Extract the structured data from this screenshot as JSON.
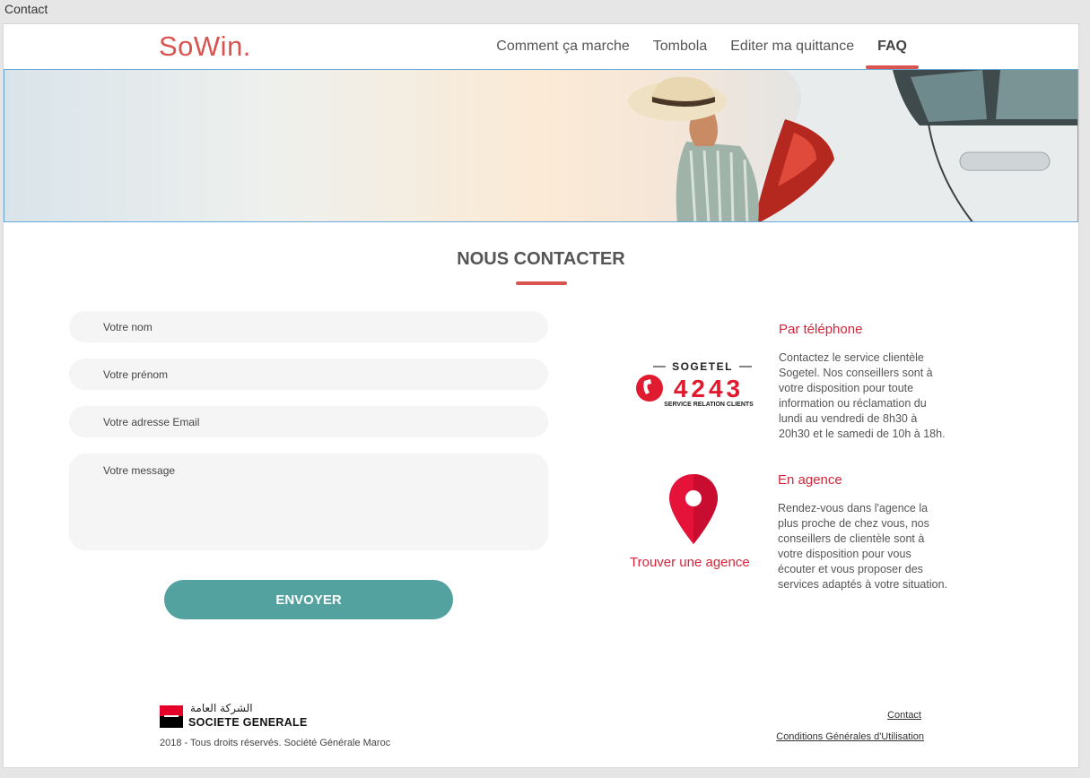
{
  "window": {
    "title": "Contact"
  },
  "header": {
    "logo": "SoWin.",
    "nav": [
      {
        "label": "Comment ça marche",
        "active": false
      },
      {
        "label": "Tombola",
        "active": false
      },
      {
        "label": "Editer ma quittance",
        "active": false
      },
      {
        "label": "FAQ",
        "active": true
      }
    ]
  },
  "main": {
    "title": "NOUS CONTACTER",
    "form": {
      "name_placeholder": "Votre nom",
      "firstname_placeholder": "Votre prénom",
      "email_placeholder": "Votre adresse Email",
      "message_placeholder": "Votre message",
      "submit_label": "ENVOYER"
    },
    "phone": {
      "logo_top": "SOGETEL",
      "logo_number": "4243",
      "logo_sub": "SERVICE RELATION CLIENTS",
      "title": "Par téléphone",
      "text": "Contactez le service clientèle Sogetel. Nos conseillers sont à votre disposition pour toute information ou réclamation du lundi au vendredi de 8h30 à 20h30 et le samedi de 10h à 18h."
    },
    "agency": {
      "title": "En agence",
      "text": "Rendez-vous dans l'agence la plus proche de chez vous, nos conseillers de clientèle sont à votre disposition pour vous écouter et vous proposer des services adaptés à votre situation.",
      "link": "Trouver une agence",
      "icon": "map-pin-icon"
    }
  },
  "footer": {
    "brand_arabic": "الشركة العامة",
    "brand_name": "SOCIETE GENERALE",
    "copyright": "2018 - Tous droits réservés. Société Générale Maroc",
    "links": [
      "Contact",
      "Conditions Générales d'Utilisation"
    ]
  },
  "colors": {
    "accent": "#d9534f",
    "button": "#53a2a0",
    "info_red": "#d6243b"
  }
}
